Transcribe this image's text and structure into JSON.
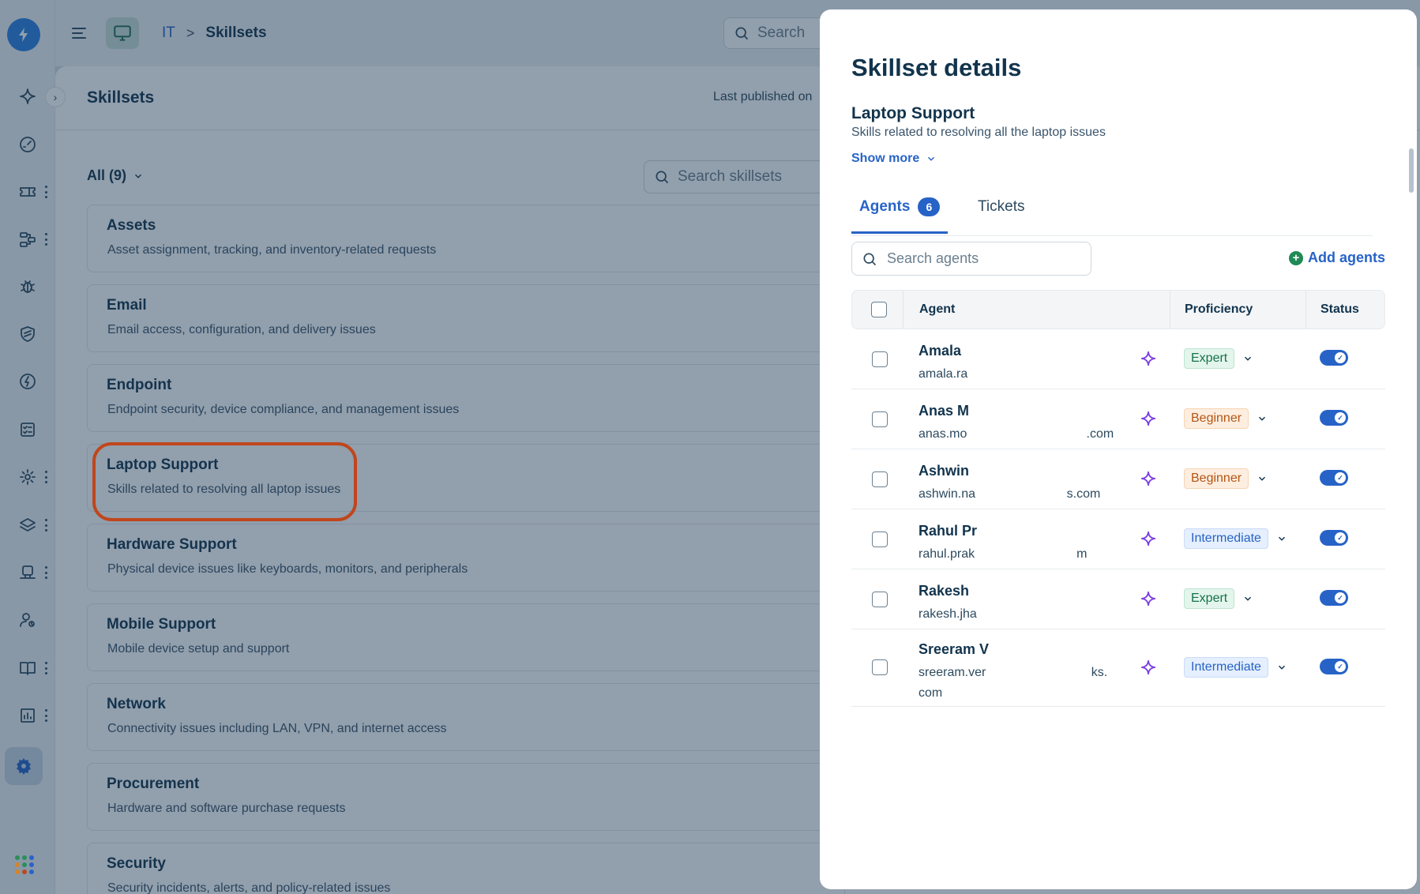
{
  "header": {
    "breadcrumb_root": "IT",
    "breadcrumb_separator": ">",
    "breadcrumb_current": "Skillsets",
    "search_placeholder": "Search"
  },
  "main": {
    "title": "Skillsets",
    "last_published": "Last published on",
    "filter_label": "All (9)",
    "search_placeholder": "Search skillsets",
    "skillsets": [
      {
        "name": "Assets",
        "description": "Asset assignment, tracking, and inventory-related requests"
      },
      {
        "name": "Email",
        "description": "Email access, configuration, and delivery issues"
      },
      {
        "name": "Endpoint",
        "description": "Endpoint security, device compliance, and management issues"
      },
      {
        "name": "Laptop Support",
        "description": "Skills related to resolving all laptop issues"
      },
      {
        "name": "Hardware Support",
        "description": "Physical device issues like keyboards, monitors, and peripherals"
      },
      {
        "name": "Mobile Support",
        "description": "Mobile device setup and support"
      },
      {
        "name": "Network",
        "description": "Connectivity issues including LAN, VPN, and internet access"
      },
      {
        "name": "Procurement",
        "description": "Hardware and software purchase requests"
      },
      {
        "name": "Security",
        "description": "Security incidents, alerts, and policy-related issues"
      }
    ]
  },
  "panel": {
    "title": "Skillset details",
    "skillset_name": "Laptop Support",
    "skillset_description": "Skills related to resolving all the laptop issues",
    "show_more": "Show more",
    "tabs": {
      "agents_label": "Agents",
      "agents_count": "6",
      "tickets_label": "Tickets"
    },
    "agent_search_placeholder": "Search agents",
    "add_agents": "Add agents",
    "columns": {
      "agent": "Agent",
      "proficiency": "Proficiency",
      "status": "Status"
    },
    "agents": [
      {
        "name": "Amala ",
        "email": "amala.ra",
        "proficiency": "Expert",
        "level": "expert",
        "status_on": true
      },
      {
        "name": "Anas M",
        "email": "anas.mo                                  .com",
        "proficiency": "Beginner",
        "level": "beginner",
        "status_on": true
      },
      {
        "name": "Ashwin ",
        "email": "ashwin.na                          s.com",
        "proficiency": "Beginner",
        "level": "beginner",
        "status_on": true
      },
      {
        "name": "Rahul Pr",
        "email": "rahul.prak                             m",
        "proficiency": "Intermediate",
        "level": "intermediate",
        "status_on": true
      },
      {
        "name": "Rakesh ",
        "email": "rakesh.jha",
        "proficiency": "Expert",
        "level": "expert",
        "status_on": true
      },
      {
        "name": "Sreeram V",
        "email": "sreeram.ver                              ks.",
        "email_line2": "com",
        "proficiency": "Intermediate",
        "level": "intermediate",
        "status_on": true
      }
    ]
  },
  "colors": {
    "brand_blue": "#2763c7",
    "highlight_ring": "#c0461c",
    "ai_sparkle": "#7b3fe4",
    "overlay": "#18344e"
  }
}
